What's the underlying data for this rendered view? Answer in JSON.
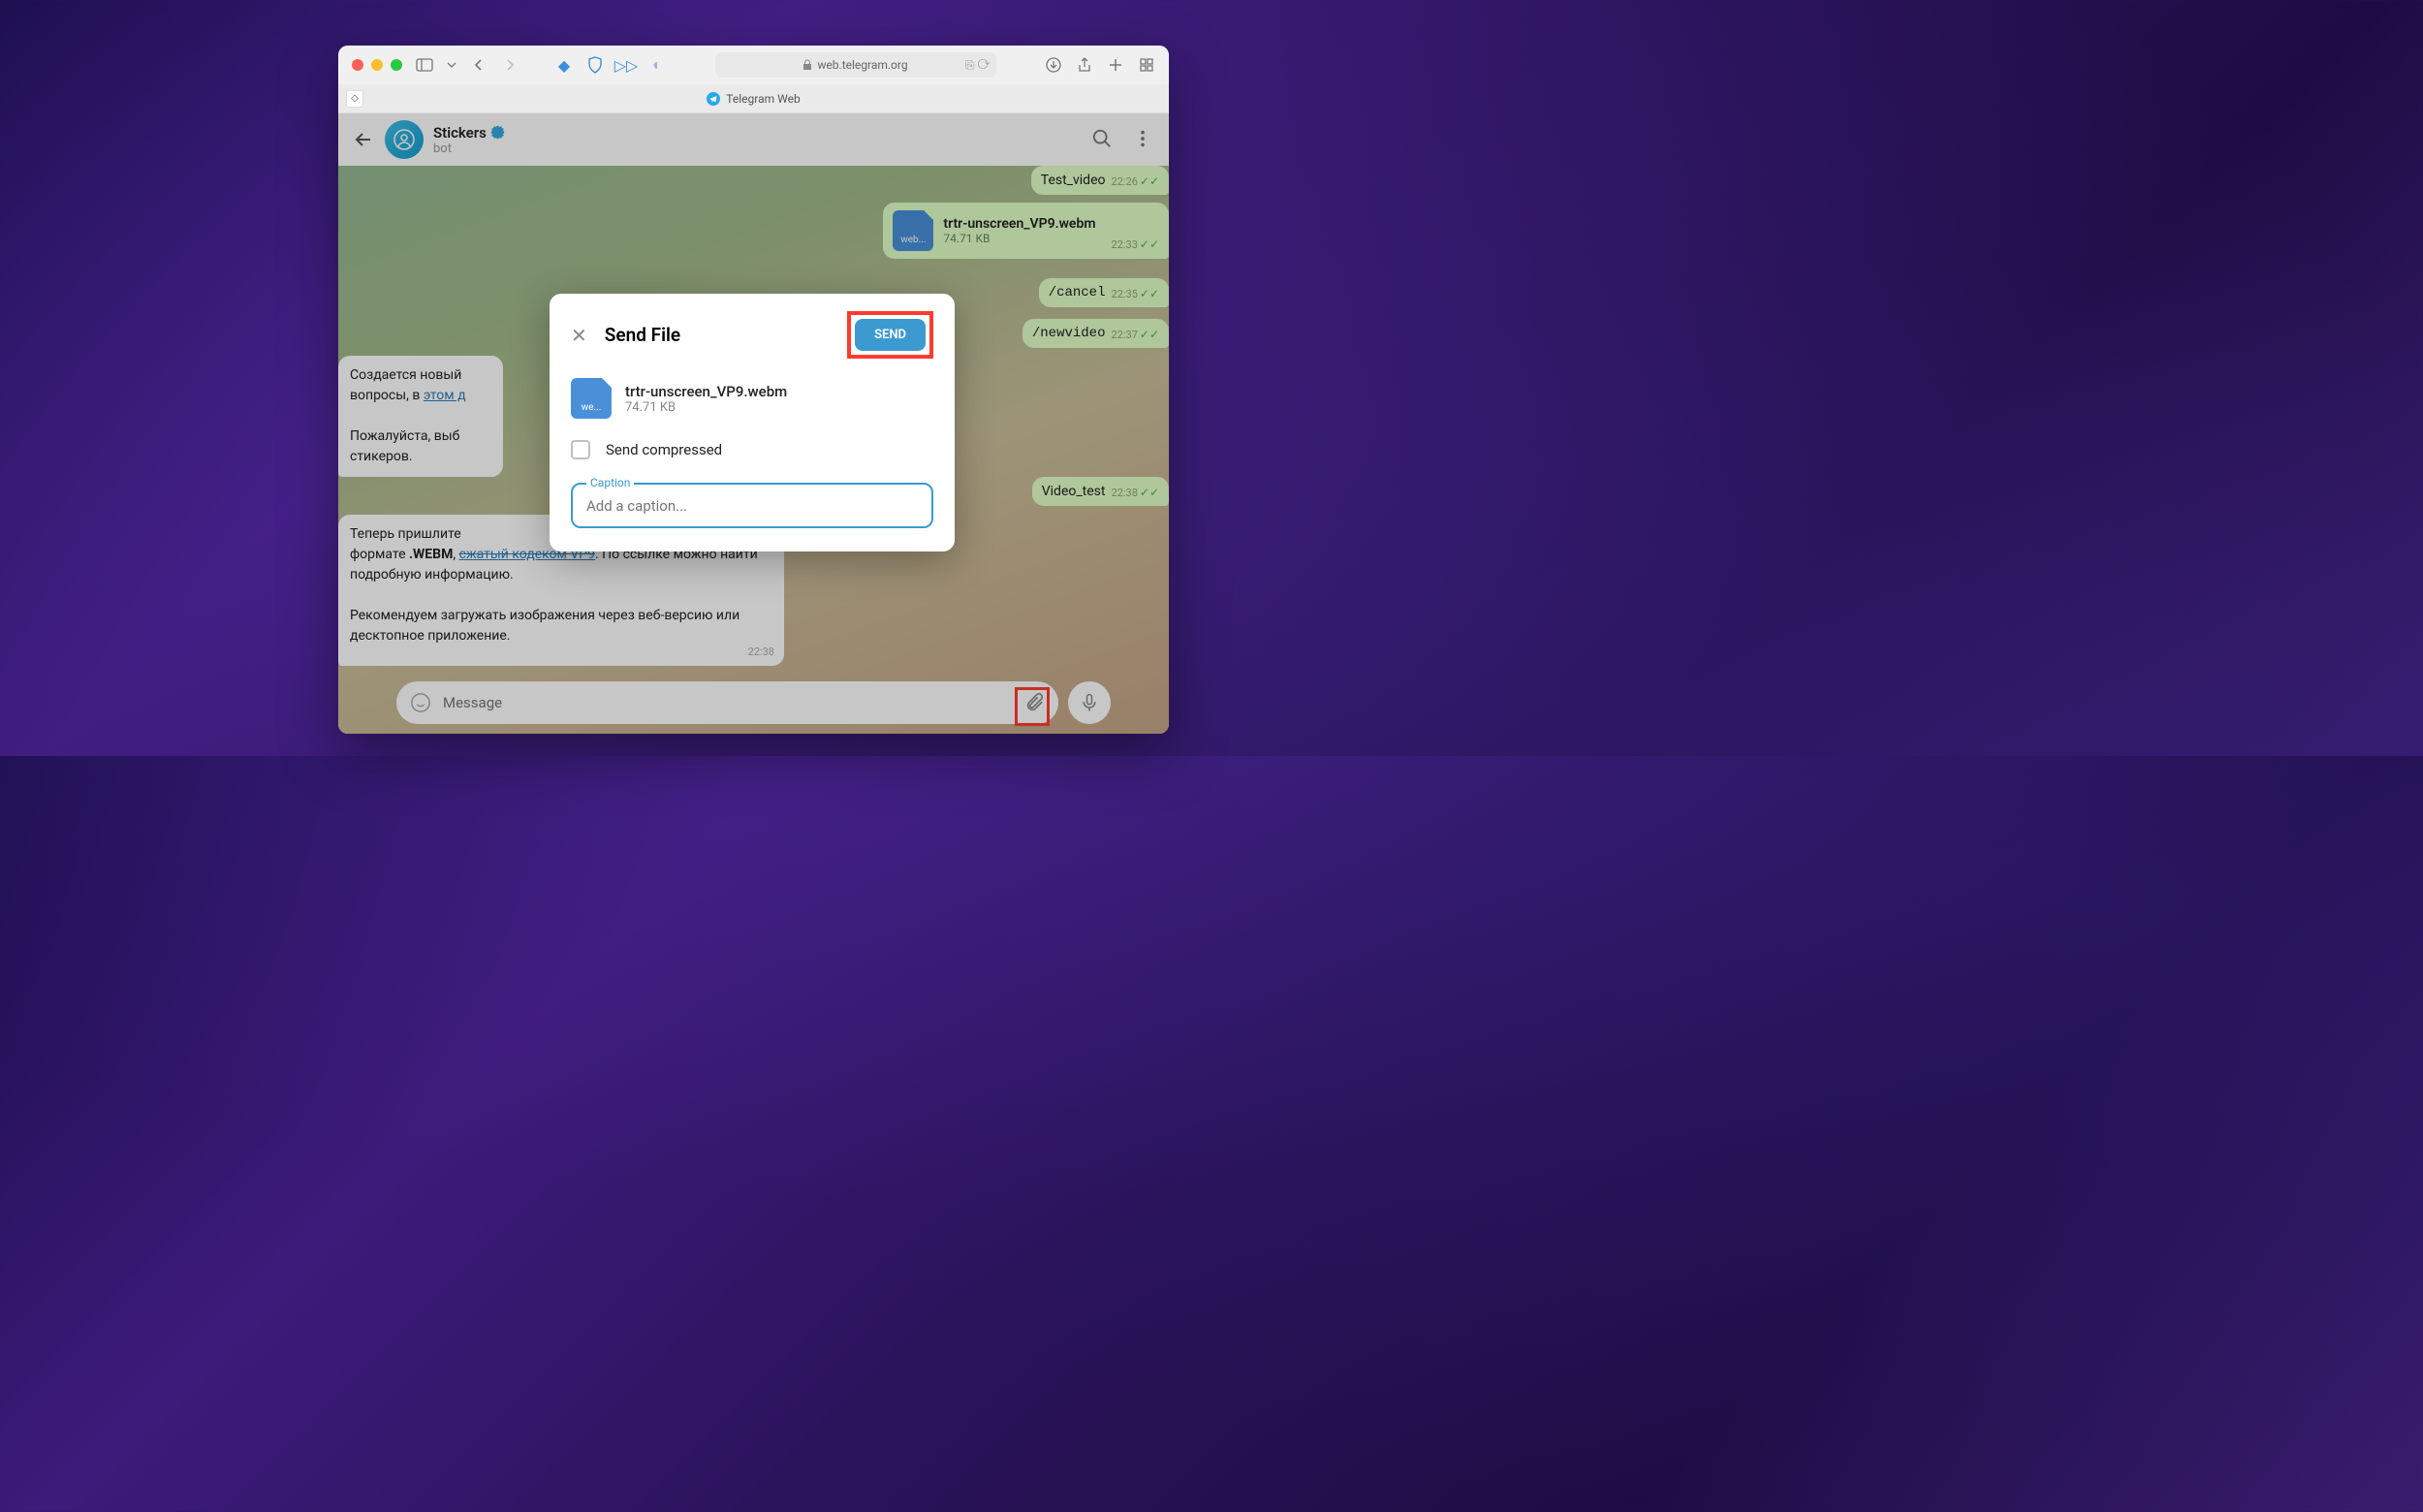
{
  "browser": {
    "address": "web.telegram.org",
    "tab_title": "Telegram Web"
  },
  "chat": {
    "name": "Stickers",
    "subtitle": "bot"
  },
  "messages": {
    "m1": {
      "text": "Test_video",
      "time": "22:26"
    },
    "m2": {
      "name": "trtr-unscreen_VP9.webm",
      "size": "74.71 KB",
      "time": "22:33"
    },
    "m3": {
      "text": "/cancel",
      "time": "22:35"
    },
    "m4": {
      "text": "/newvideo",
      "time": "22:37"
    },
    "m5_partial": {
      "seg1": "Создается новый",
      "seg2": "вопросы, в ",
      "link": "этом д"
    },
    "m5b": {
      "seg1": "Пожалуйста, выб",
      "seg2": "стикеров."
    },
    "m6": {
      "text": "Video_test",
      "time": "22:38"
    },
    "m7": {
      "line1a": "Теперь пришлите",
      "line1b": "формате ",
      "webm": ".WEBM",
      "comma": ", ",
      "link": "сжатый кодеком VP9",
      "tail": ". По ссылке можно найти подробную информацию.",
      "line2": "Рекомендуем загружать изображения через веб-версию или десктопное приложение.",
      "time": "22:38"
    }
  },
  "composer": {
    "placeholder": "Message"
  },
  "modal": {
    "title": "Send File",
    "send": "SEND",
    "file_name": "trtr-unscreen_VP9.webm",
    "file_size": "74.71 KB",
    "file_ext": "we...",
    "compress_label": "Send compressed",
    "caption_label": "Caption",
    "caption_placeholder": "Add a caption..."
  },
  "icons": {
    "file_ext": "web..."
  }
}
